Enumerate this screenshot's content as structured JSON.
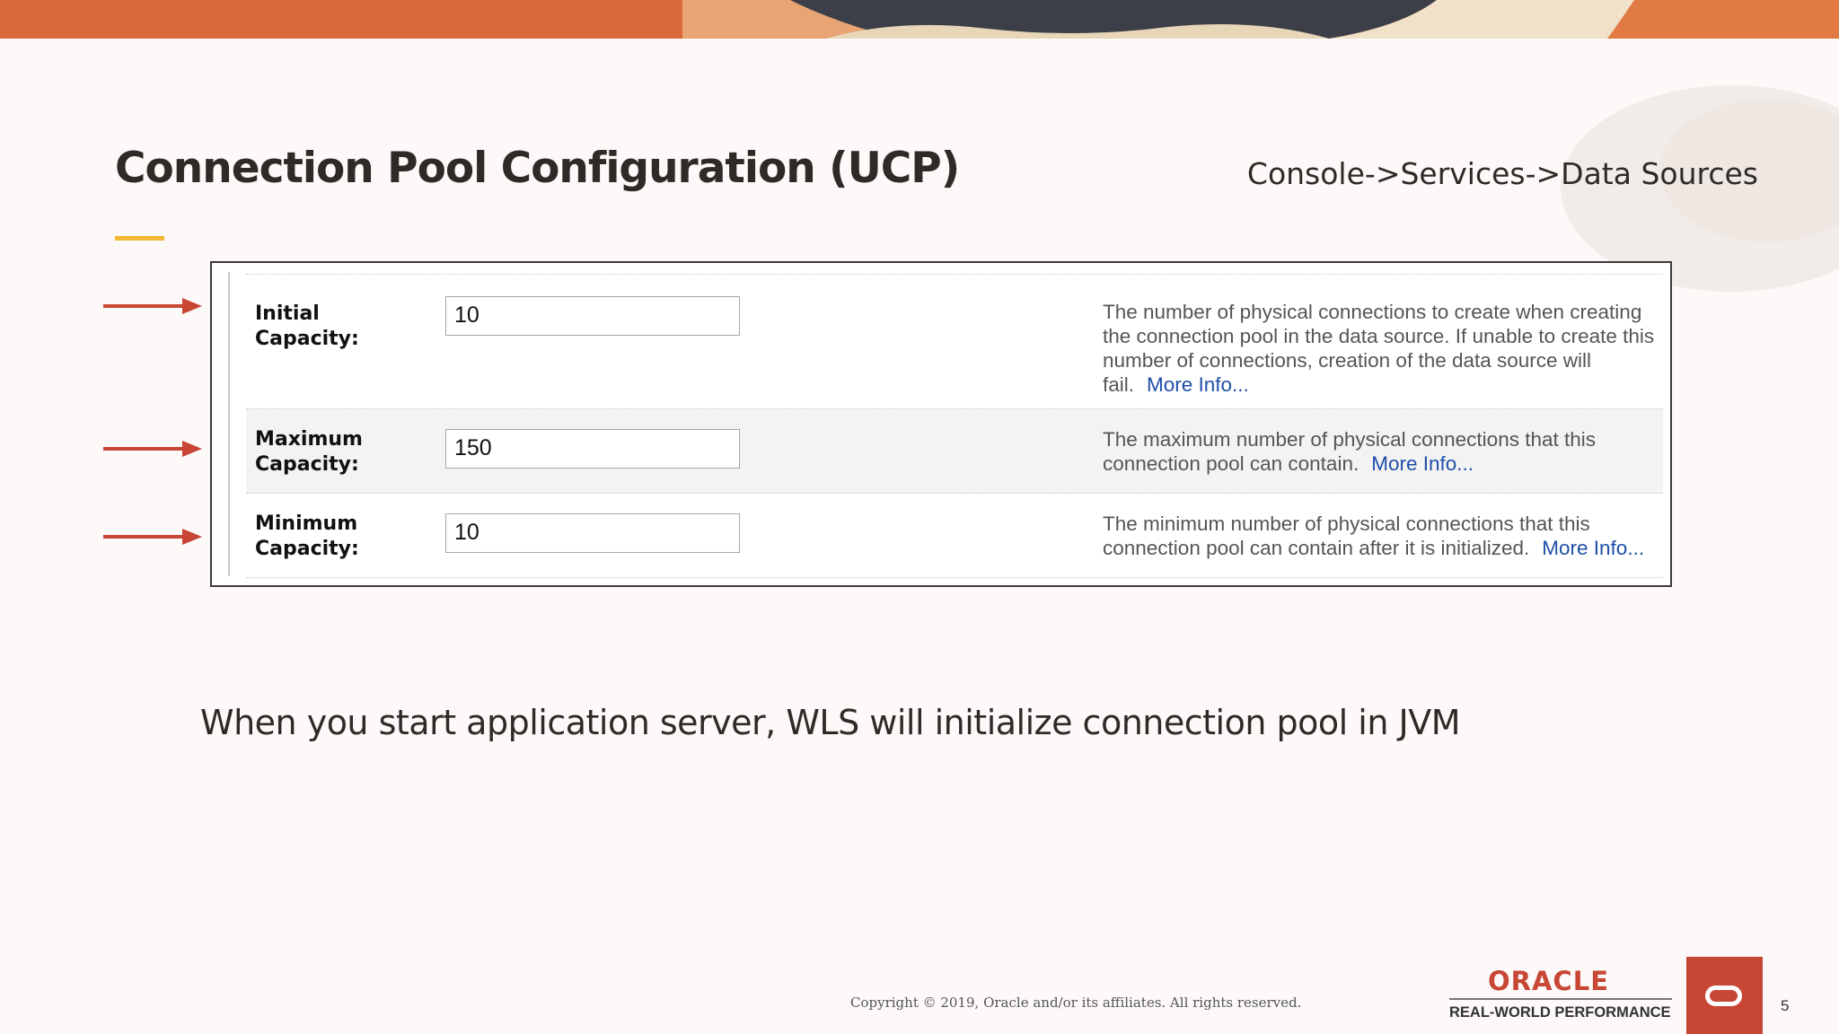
{
  "slide": {
    "title": "Connection Pool Configuration (UCP)",
    "breadcrumb": "Console->Services->Data Sources",
    "statement": "When you start application server, WLS will initialize connection pool in JVM",
    "copyright": "Copyright © 2019, Oracle and/or its affiliates. All rights reserved.",
    "page_number": "5"
  },
  "branding": {
    "oracle": "ORACLE",
    "tagline": "REAL-WORLD PERFORMANCE"
  },
  "colors": {
    "accent_red": "#c74634",
    "accent_yellow": "#f3b731",
    "link_blue": "#1f4ea8"
  },
  "pool_settings": [
    {
      "label": "Initial Capacity:",
      "value": "10",
      "description": "The number of physical connections to create when creating the connection pool in the data source. If unable to create this number of connections, creation of the data source will fail.",
      "more": "More Info..."
    },
    {
      "label": "Maximum Capacity:",
      "value": "150",
      "description": "The maximum number of physical connections that this connection pool can contain.",
      "more": "More Info..."
    },
    {
      "label": "Minimum Capacity:",
      "value": "10",
      "description": "The minimum number of physical connections that this connection pool can contain after it is initialized.",
      "more": "More Info..."
    }
  ]
}
